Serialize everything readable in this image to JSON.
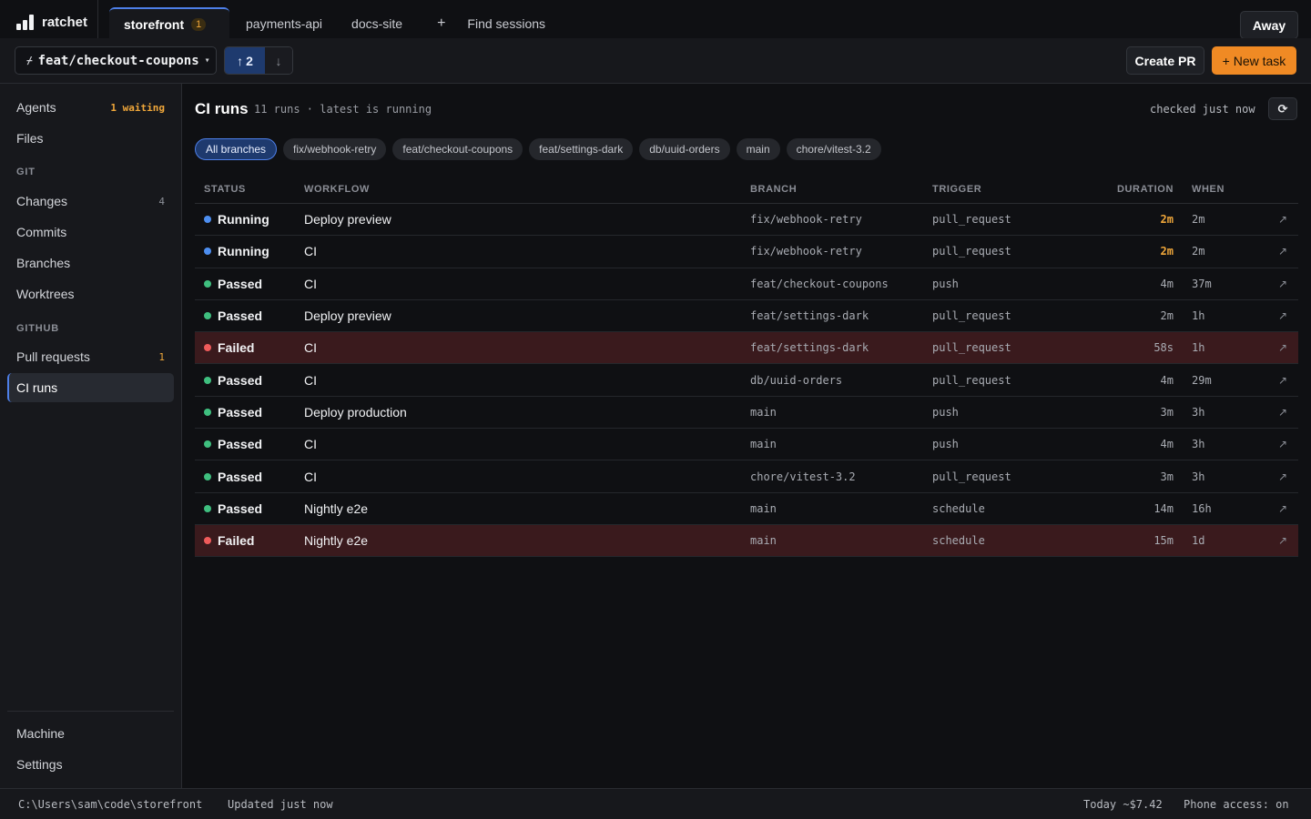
{
  "app": {
    "name": "ratchet"
  },
  "tabs": [
    {
      "label": "storefront",
      "badge": "1",
      "active": true
    },
    {
      "label": "payments-api"
    },
    {
      "label": "docs-site"
    }
  ],
  "tab_add": "+",
  "find_sessions": "Find sessions",
  "away_label": "Away",
  "toolbar": {
    "branch": "feat/checkout-coupons",
    "ahead": "2",
    "create_pr": "Create PR",
    "new_task": "+ New task"
  },
  "sidebar": {
    "agents": {
      "label": "Agents",
      "count": "1 waiting"
    },
    "files": {
      "label": "Files"
    },
    "git_section": "GIT",
    "changes": {
      "label": "Changes",
      "count": "4"
    },
    "commits": {
      "label": "Commits"
    },
    "branches": {
      "label": "Branches"
    },
    "worktrees": {
      "label": "Worktrees"
    },
    "github_section": "GITHUB",
    "pull_requests": {
      "label": "Pull requests",
      "count": "1"
    },
    "ci_runs": {
      "label": "CI runs"
    },
    "machine": {
      "label": "Machine"
    },
    "settings": {
      "label": "Settings"
    }
  },
  "main": {
    "title": "CI runs",
    "summary": "11 runs · latest is running",
    "checked": "checked just now",
    "filters": [
      "All branches",
      "fix/webhook-retry",
      "feat/checkout-coupons",
      "feat/settings-dark",
      "db/uuid-orders",
      "main",
      "chore/vitest-3.2"
    ],
    "columns": {
      "status": "STATUS",
      "workflow": "WORKFLOW",
      "branch": "BRANCH",
      "trigger": "TRIGGER",
      "duration": "DURATION",
      "when": "WHEN"
    },
    "runs": [
      {
        "status": "Running",
        "workflow": "Deploy preview",
        "branch": "fix/webhook-retry",
        "trigger": "pull_request",
        "duration": "2m",
        "when": "2m"
      },
      {
        "status": "Running",
        "workflow": "CI",
        "branch": "fix/webhook-retry",
        "trigger": "pull_request",
        "duration": "2m",
        "when": "2m"
      },
      {
        "status": "Passed",
        "workflow": "CI",
        "branch": "feat/checkout-coupons",
        "trigger": "push",
        "duration": "4m",
        "when": "37m"
      },
      {
        "status": "Passed",
        "workflow": "Deploy preview",
        "branch": "feat/settings-dark",
        "trigger": "pull_request",
        "duration": "2m",
        "when": "1h"
      },
      {
        "status": "Failed",
        "workflow": "CI",
        "branch": "feat/settings-dark",
        "trigger": "pull_request",
        "duration": "58s",
        "when": "1h"
      },
      {
        "status": "Passed",
        "workflow": "CI",
        "branch": "db/uuid-orders",
        "trigger": "pull_request",
        "duration": "4m",
        "when": "29m"
      },
      {
        "status": "Passed",
        "workflow": "Deploy production",
        "branch": "main",
        "trigger": "push",
        "duration": "3m",
        "when": "3h"
      },
      {
        "status": "Passed",
        "workflow": "CI",
        "branch": "main",
        "trigger": "push",
        "duration": "4m",
        "when": "3h"
      },
      {
        "status": "Passed",
        "workflow": "CI",
        "branch": "chore/vitest-3.2",
        "trigger": "pull_request",
        "duration": "3m",
        "when": "3h"
      },
      {
        "status": "Passed",
        "workflow": "Nightly e2e",
        "branch": "main",
        "trigger": "schedule",
        "duration": "14m",
        "when": "16h"
      },
      {
        "status": "Failed",
        "workflow": "Nightly e2e",
        "branch": "main",
        "trigger": "schedule",
        "duration": "15m",
        "when": "1d"
      }
    ]
  },
  "status_colors": {
    "Running": "#4d8ef0",
    "Passed": "#3fbf7f",
    "Failed": "#ef5b5b"
  },
  "statusbar": {
    "path": "C:\\Users\\sam\\code\\storefront",
    "updated": "Updated just now",
    "cost": "Today ~$7.42",
    "phone": "Phone access: on"
  }
}
